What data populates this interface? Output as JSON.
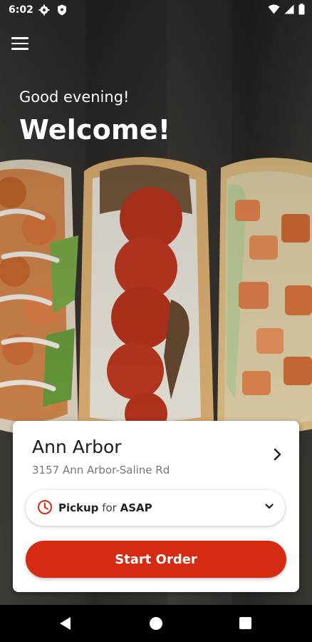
{
  "status_bar": {
    "time": "6:02",
    "left_icons": [
      "gear-icon",
      "shield-icon"
    ],
    "right_icons": [
      "wifi-icon",
      "signal-icon",
      "battery-icon"
    ]
  },
  "header": {
    "menu_icon": "hamburger-menu-icon",
    "greeting": "Good evening!",
    "welcome": "Welcome!"
  },
  "location_card": {
    "store_name": "Ann Arbor",
    "store_address": "3157 Ann Arbor-Saline Rd",
    "order_mode": {
      "mode": "Pickup",
      "connector": "for",
      "time": "ASAP"
    },
    "start_button_label": "Start Order"
  },
  "colors": {
    "accent": "#d52b12",
    "card_background": "#ffffff",
    "text_primary": "#1c1c1c",
    "text_secondary": "#777777"
  },
  "nav_bar": {
    "buttons": [
      "back-icon",
      "home-icon",
      "recents-icon"
    ]
  }
}
